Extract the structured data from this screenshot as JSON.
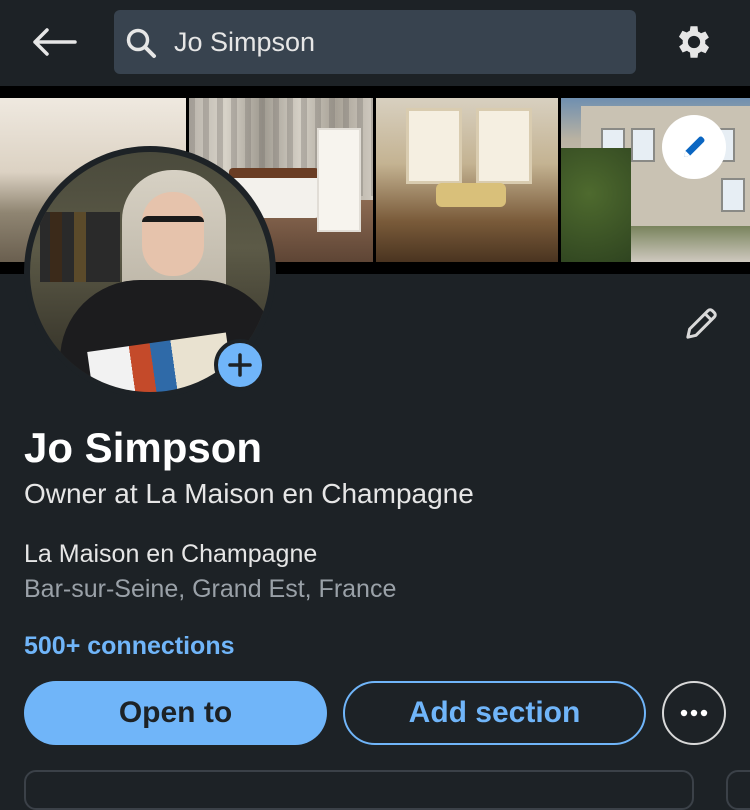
{
  "header": {
    "back_icon": "arrow-left-icon",
    "search": {
      "icon": "search-icon",
      "value": "Jo Simpson"
    },
    "settings_icon": "gear-icon"
  },
  "banner": {
    "photos": [
      "bedroom-photo",
      "bedroom-striped-photo",
      "salon-photo",
      "house-exterior-photo"
    ],
    "edit_icon": "pencil-icon"
  },
  "profile": {
    "name": "Jo Simpson",
    "headline": "Owner at La Maison en Champagne",
    "company": "La Maison en Champagne",
    "location": "Bar-sur-Seine, Grand Est, France",
    "connections": "500+ connections",
    "edit_icon": "pencil-icon",
    "add_photo_icon": "plus-icon"
  },
  "actions": {
    "open_to": "Open to",
    "add_section": "Add section",
    "more_icon": "more-horizontal-icon"
  },
  "colors": {
    "background": "#1d2226",
    "accent": "#70b5f9",
    "search_bg": "#38434f",
    "muted_text": "#9aa1a8"
  }
}
